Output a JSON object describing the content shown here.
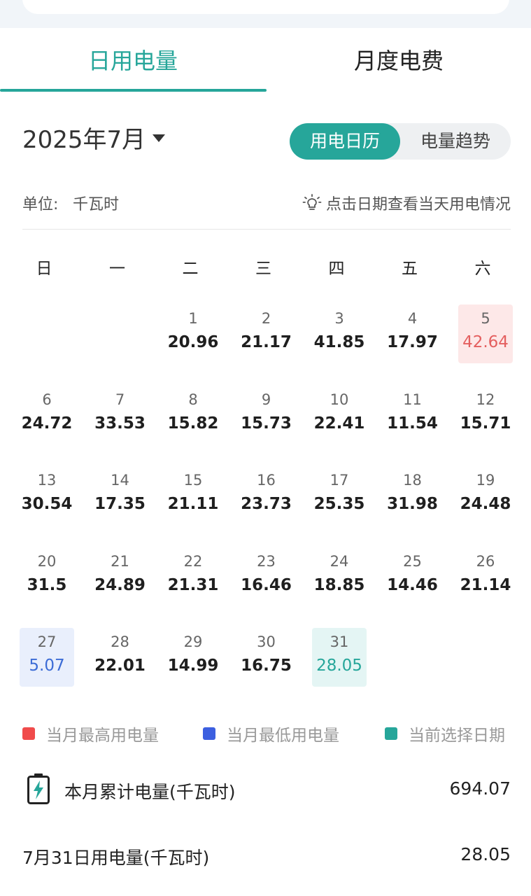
{
  "tabs": {
    "daily": "日用电量",
    "monthly": "月度电费"
  },
  "month_selector": {
    "label": "2025年7月"
  },
  "view_toggle": {
    "calendar": "用电日历",
    "trend": "电量趋势"
  },
  "unit": {
    "label": "单位:",
    "value": "千瓦时"
  },
  "hint": "点击日期查看当天用电情况",
  "weekdays": [
    "日",
    "一",
    "二",
    "三",
    "四",
    "五",
    "六"
  ],
  "calendar": {
    "days": [
      {
        "day": "1",
        "kwh": "20.96"
      },
      {
        "day": "2",
        "kwh": "21.17"
      },
      {
        "day": "3",
        "kwh": "41.85"
      },
      {
        "day": "4",
        "kwh": "17.97"
      },
      {
        "day": "5",
        "kwh": "42.64"
      },
      {
        "day": "6",
        "kwh": "24.72"
      },
      {
        "day": "7",
        "kwh": "33.53"
      },
      {
        "day": "8",
        "kwh": "15.82"
      },
      {
        "day": "9",
        "kwh": "15.73"
      },
      {
        "day": "10",
        "kwh": "22.41"
      },
      {
        "day": "11",
        "kwh": "11.54"
      },
      {
        "day": "12",
        "kwh": "15.71"
      },
      {
        "day": "13",
        "kwh": "30.54"
      },
      {
        "day": "14",
        "kwh": "17.35"
      },
      {
        "day": "15",
        "kwh": "21.11"
      },
      {
        "day": "16",
        "kwh": "23.73"
      },
      {
        "day": "17",
        "kwh": "25.35"
      },
      {
        "day": "18",
        "kwh": "31.98"
      },
      {
        "day": "19",
        "kwh": "24.48"
      },
      {
        "day": "20",
        "kwh": "31.5"
      },
      {
        "day": "21",
        "kwh": "24.89"
      },
      {
        "day": "22",
        "kwh": "21.31"
      },
      {
        "day": "23",
        "kwh": "16.46"
      },
      {
        "day": "24",
        "kwh": "18.85"
      },
      {
        "day": "25",
        "kwh": "14.46"
      },
      {
        "day": "26",
        "kwh": "21.14"
      },
      {
        "day": "27",
        "kwh": "5.07"
      },
      {
        "day": "28",
        "kwh": "22.01"
      },
      {
        "day": "29",
        "kwh": "14.99"
      },
      {
        "day": "30",
        "kwh": "16.75"
      },
      {
        "day": "31",
        "kwh": "28.05"
      }
    ],
    "max_day": "5",
    "min_day": "27",
    "selected_day": "31"
  },
  "legend": {
    "max": "当月最高用电量",
    "min": "当月最低用电量",
    "selected": "当前选择日期"
  },
  "colors": {
    "accent": "#26a69a",
    "max": "#f04b4b",
    "min": "#3c5fe0",
    "selected": "#26a69a"
  },
  "icons": {
    "hint": "lightbulb-icon",
    "summary": "battery-charging-icon",
    "month": "caret-down-icon"
  },
  "summary": {
    "month_total_label": "本月累计电量(千瓦时)",
    "month_total_value": "694.07",
    "selected_day_label": "7月31日用电量(千瓦时)",
    "selected_day_value": "28.05"
  }
}
